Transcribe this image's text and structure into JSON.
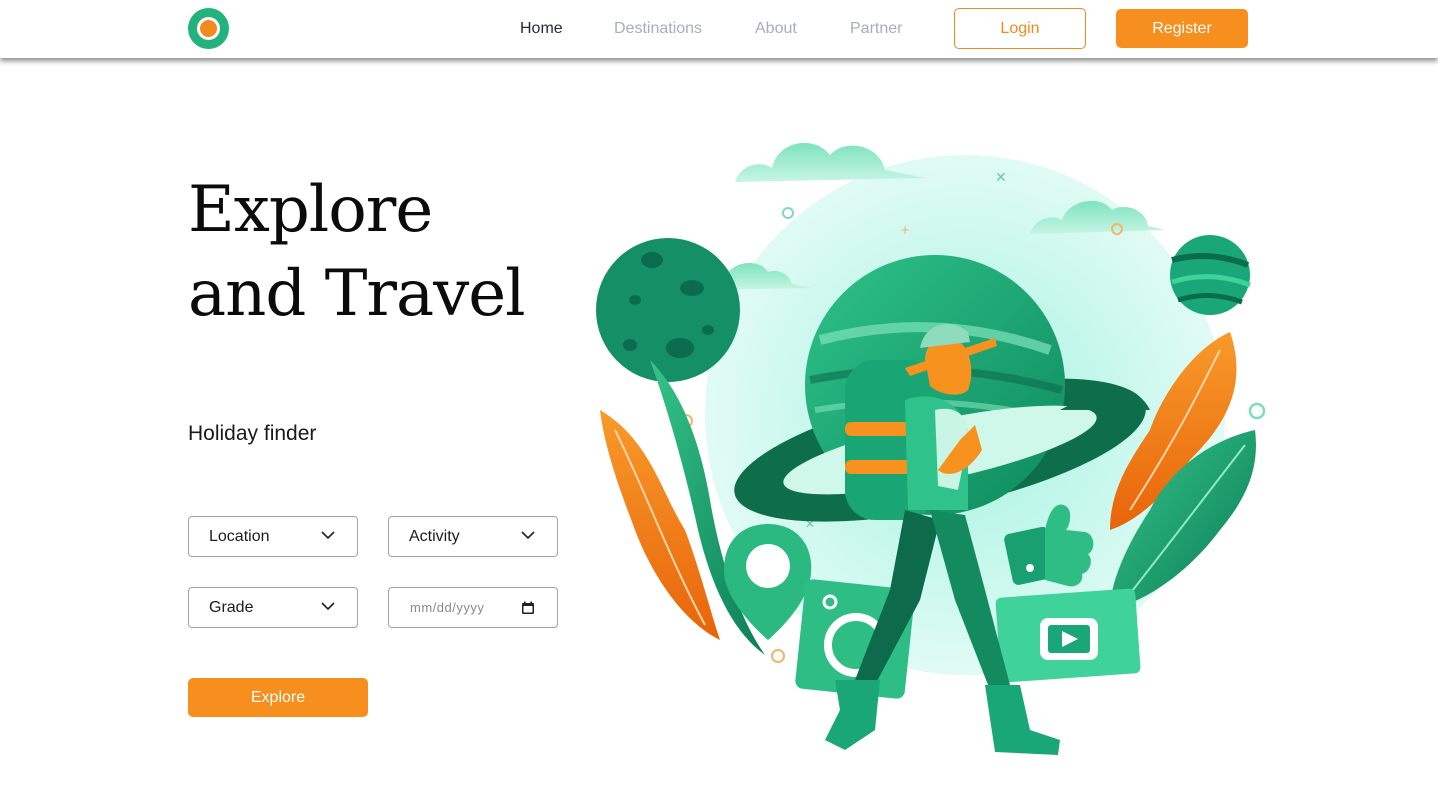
{
  "nav": {
    "links": [
      {
        "label": "Home",
        "active": true
      },
      {
        "label": "Destinations",
        "active": false
      },
      {
        "label": "About",
        "active": false
      },
      {
        "label": "Partner",
        "active": false
      }
    ],
    "login_label": "Login",
    "register_label": "Register"
  },
  "hero": {
    "title_line1": "Explore",
    "title_line2": "and Travel",
    "subtitle": "Holiday finder"
  },
  "form": {
    "location": "Location",
    "activity": "Activity",
    "grade": "Grade",
    "date_placeholder": "mm/dd/yyyy",
    "explore_label": "Explore"
  },
  "colors": {
    "accent": "#f78f1e",
    "brand_green": "#23b27c",
    "nav_inactive": "#a9adbd",
    "nav_active": "#26293a"
  },
  "icons": [
    "chevron-down-icon",
    "calendar-icon"
  ]
}
